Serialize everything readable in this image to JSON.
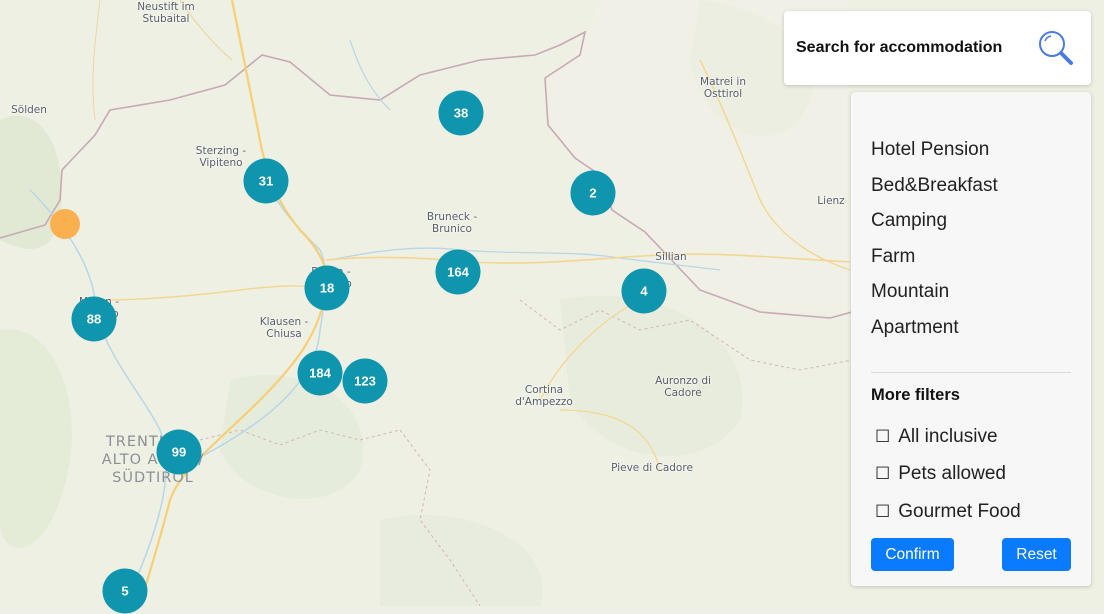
{
  "map": {
    "place_labels": [
      "Neustift im\nStubaital",
      "Sölden",
      "Sterzing -\nVipiteno",
      "Matrei in\nOsttirol",
      "Bruneck -\nBrunico",
      "Sillian",
      "Lienz",
      "Bozen -\nBolzano",
      "Klausen -\nChiusa",
      "Meran -\nMerano",
      "Cortina\nd'Ampezzo",
      "Auronzo di\nCadore",
      "Pieve di Cadore"
    ],
    "region_label": "TRENTINO -\nALTO ADIGE/\nSÜDTIROL",
    "clusters": [
      {
        "count": "38"
      },
      {
        "count": "31"
      },
      {
        "count": "2"
      },
      {
        "count": "164"
      },
      {
        "count": "18"
      },
      {
        "count": "4"
      },
      {
        "count": "88"
      },
      {
        "count": "184"
      },
      {
        "count": "123"
      },
      {
        "count": "99"
      },
      {
        "count": "5"
      }
    ],
    "colors": {
      "cluster": "#0f95ae",
      "single_marker": "#fbb04f",
      "border": "#c8a9b4"
    }
  },
  "search": {
    "label": "Search for accommodation",
    "icon": "magnifier-icon"
  },
  "filters": {
    "types": [
      "Hotel Pension",
      "Bed&Breakfast",
      "Camping",
      "Farm",
      "Mountain",
      "Apartment"
    ],
    "more_title": "More filters",
    "checkboxes": [
      {
        "label": "All inclusive",
        "checked": false
      },
      {
        "label": "Pets allowed",
        "checked": false
      },
      {
        "label": "Gourmet Food",
        "checked": false
      }
    ],
    "checkbox_glyph": "☐",
    "confirm_label": "Confirm",
    "reset_label": "Reset"
  }
}
